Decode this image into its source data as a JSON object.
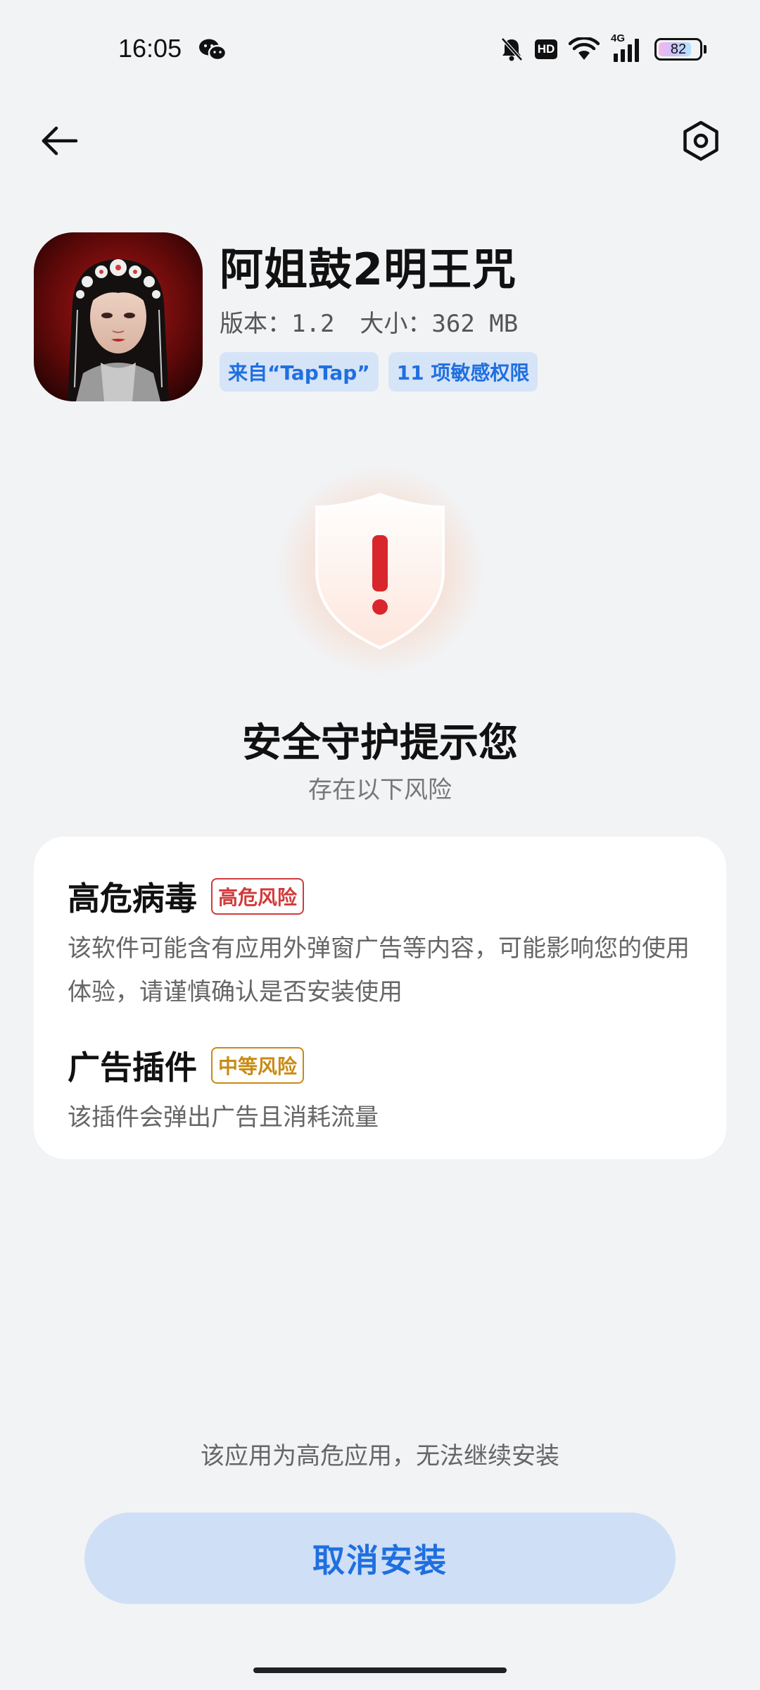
{
  "status_bar": {
    "time": "16:05",
    "network": "4G",
    "hd": "HD",
    "battery": "82",
    "battery_level": 0.82,
    "icons": [
      "wechat-icon",
      "mute-bell-icon",
      "hd-icon",
      "wifi-icon",
      "signal-icon",
      "battery-icon"
    ]
  },
  "nav": {
    "back_icon": "arrow-left-icon",
    "settings_icon": "hexagon-settings-icon"
  },
  "app": {
    "name": "阿姐鼓2明王咒",
    "version": "版本：1.2",
    "size": "大小：362 MB",
    "tags": [
      "来自“TapTap”",
      "11 项敏感权限"
    ]
  },
  "safety": {
    "title": "安全守护提示您",
    "subtitle": "存在以下风险"
  },
  "risks": [
    {
      "name": "高危病毒",
      "level": "高危风险",
      "description": "该软件可能含有应用外弹窗广告等内容，可能影响您的使用体验，请谨慎确认是否安装使用"
    },
    {
      "name": "广告插件",
      "level": "中等风险",
      "description": "该插件会弹出广告且消耗流量"
    }
  ],
  "bottom": {
    "notice": "该应用为高危应用，无法继续安装",
    "cancel_button": "取消安装"
  },
  "colors": {
    "accent": "#1f6fe0",
    "high_risk": "#d23a3a",
    "mid_risk": "#c98a12",
    "background": "#f2f3f5"
  }
}
